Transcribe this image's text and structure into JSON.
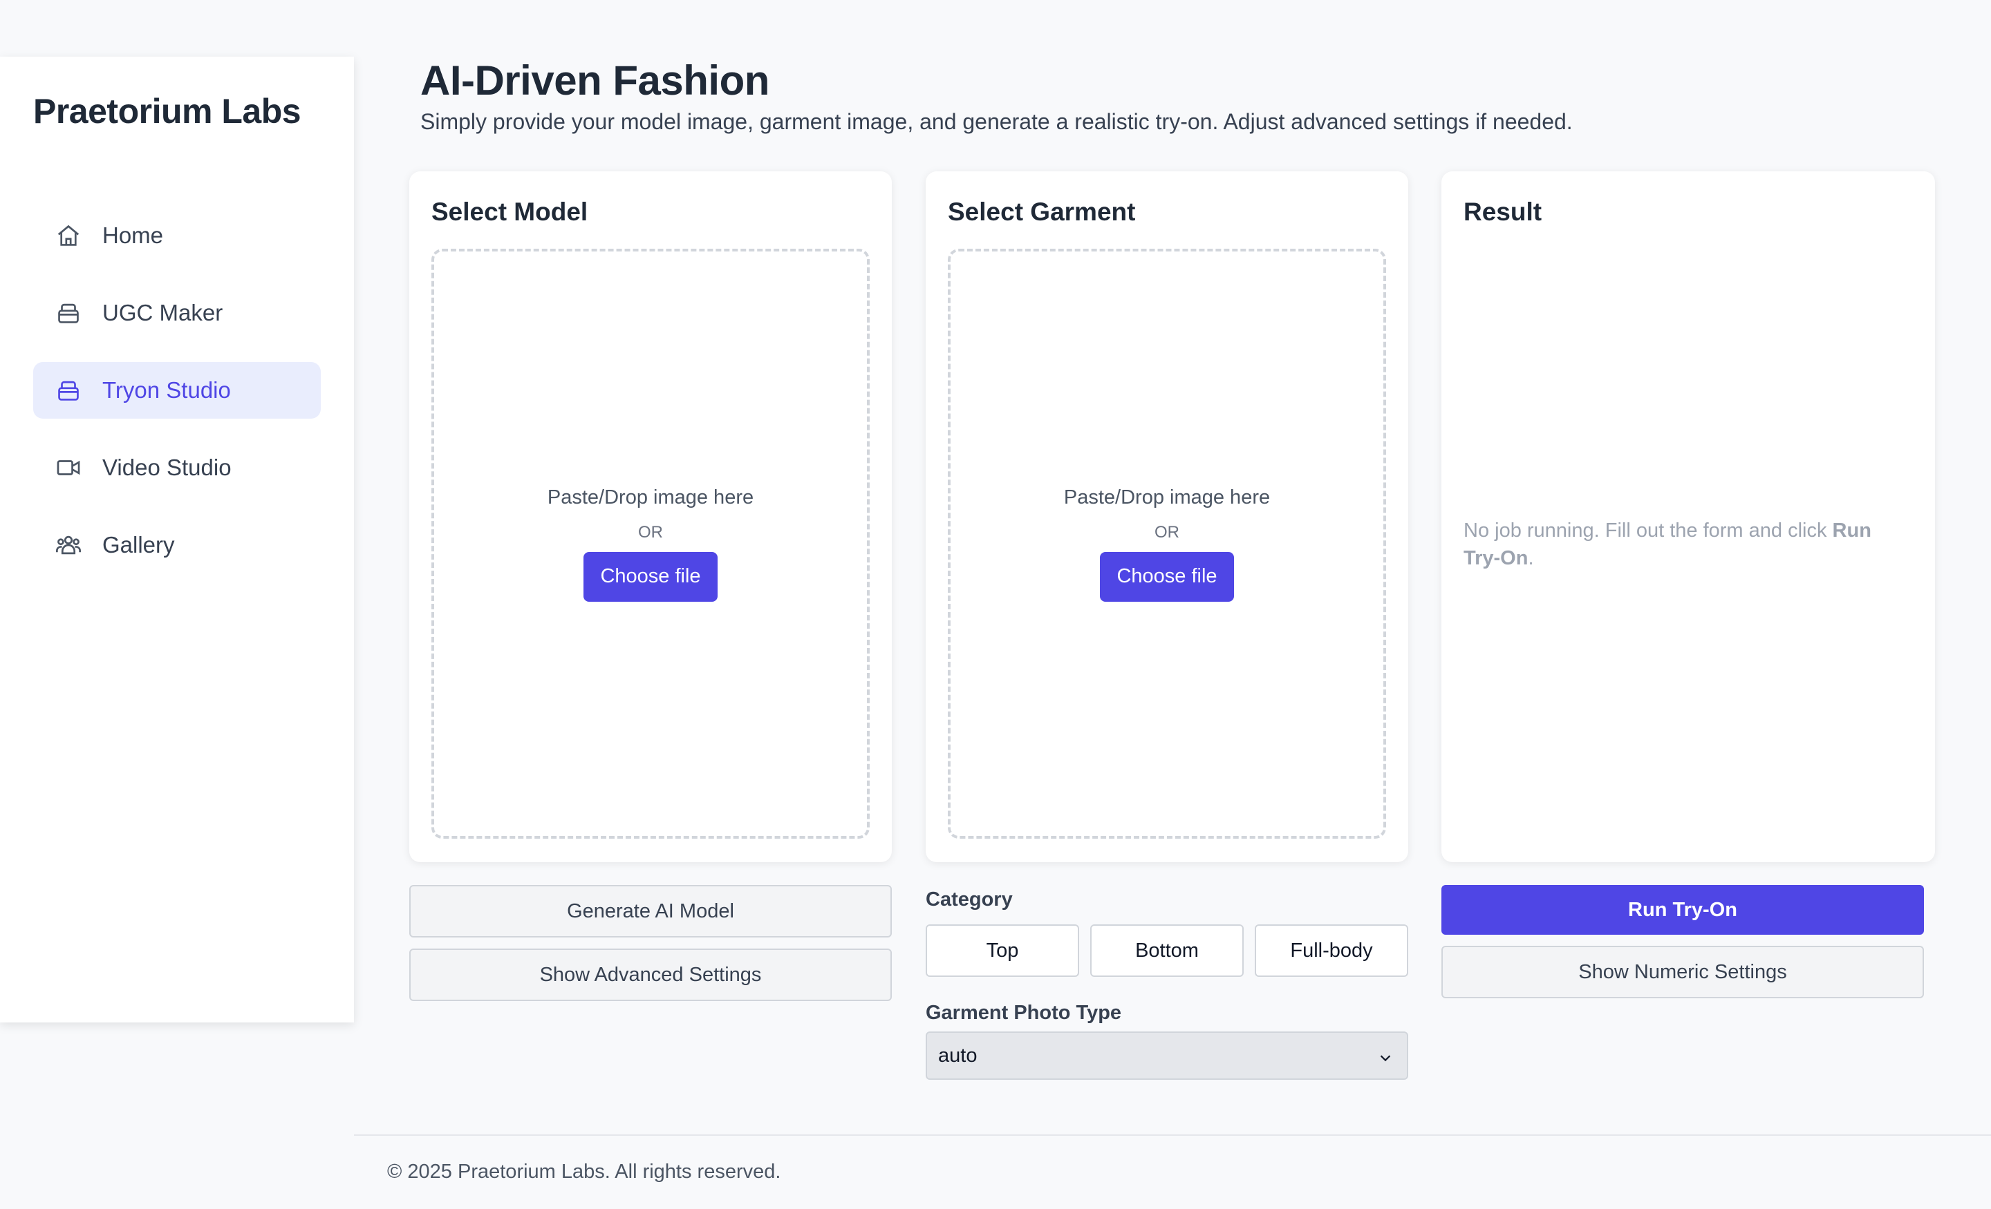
{
  "sidebar": {
    "brand": "Praetorium Labs",
    "items": [
      {
        "label": "Home",
        "icon": "home-icon"
      },
      {
        "label": "UGC Maker",
        "icon": "bag-icon"
      },
      {
        "label": "Tryon Studio",
        "icon": "bag-icon",
        "active": true
      },
      {
        "label": "Video Studio",
        "icon": "video-camera-icon"
      },
      {
        "label": "Gallery",
        "icon": "users-icon"
      }
    ]
  },
  "header": {
    "title": "AI-Driven Fashion",
    "subtitle": "Simply provide your model image, garment image, and generate a realistic try-on. Adjust advanced settings if needed."
  },
  "model_card": {
    "title": "Select Model",
    "drop_text": "Paste/Drop image here",
    "or_text": "OR",
    "choose_label": "Choose file",
    "generate_label": "Generate AI Model",
    "advanced_label": "Show Advanced Settings"
  },
  "garment_card": {
    "title": "Select Garment",
    "drop_text": "Paste/Drop image here",
    "or_text": "OR",
    "choose_label": "Choose file",
    "category_label": "Category",
    "categories": [
      "Top",
      "Bottom",
      "Full-body"
    ],
    "photo_type_label": "Garment Photo Type",
    "photo_type_value": "auto"
  },
  "result_card": {
    "title": "Result",
    "message_prefix": "No job running. Fill out the form and click ",
    "message_bold": "Run Try-On",
    "message_suffix": ".",
    "run_label": "Run Try-On",
    "numeric_label": "Show Numeric Settings"
  },
  "footer": {
    "text": "© 2025 Praetorium Labs. All rights reserved."
  },
  "colors": {
    "accent": "#4f46e5",
    "active_bg": "#e9edfd",
    "page_bg": "#f8f9fb"
  }
}
